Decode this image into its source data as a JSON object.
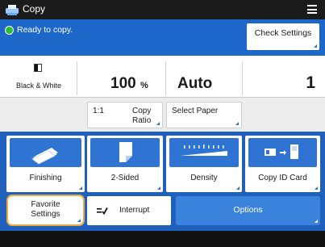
{
  "header": {
    "title": "Copy",
    "app_icon": "copy-machine-icon",
    "menu_icon": "hamburger-menu-icon"
  },
  "status": {
    "text": "Ready to copy.",
    "indicator_color": "#2fbd2f",
    "check_settings_label": "Check Settings"
  },
  "info": {
    "color_mode": "Black & White",
    "copy_ratio": "100",
    "copy_ratio_unit": "%",
    "paper": "Auto",
    "copies": "1"
  },
  "ratio_controls": {
    "one_to_one": "1:1",
    "copy_ratio_line1": "Copy",
    "copy_ratio_line2": "Ratio",
    "select_paper": "Select Paper"
  },
  "functions": [
    {
      "label": "Finishing",
      "icon": "finishing-icon"
    },
    {
      "label": "2-Sided",
      "icon": "two-sided-icon"
    },
    {
      "label": "Density",
      "icon": "density-icon"
    },
    {
      "label": "Copy ID Card",
      "icon": "id-card-copy-icon"
    }
  ],
  "bottom": {
    "favorite_line1": "Favorite",
    "favorite_line2": "Settings",
    "interrupt": "Interrupt",
    "options": "Options"
  },
  "colors": {
    "accent_blue": "#2060bd",
    "button_blue": "#3a82dc",
    "highlight": "#f2a93b"
  }
}
